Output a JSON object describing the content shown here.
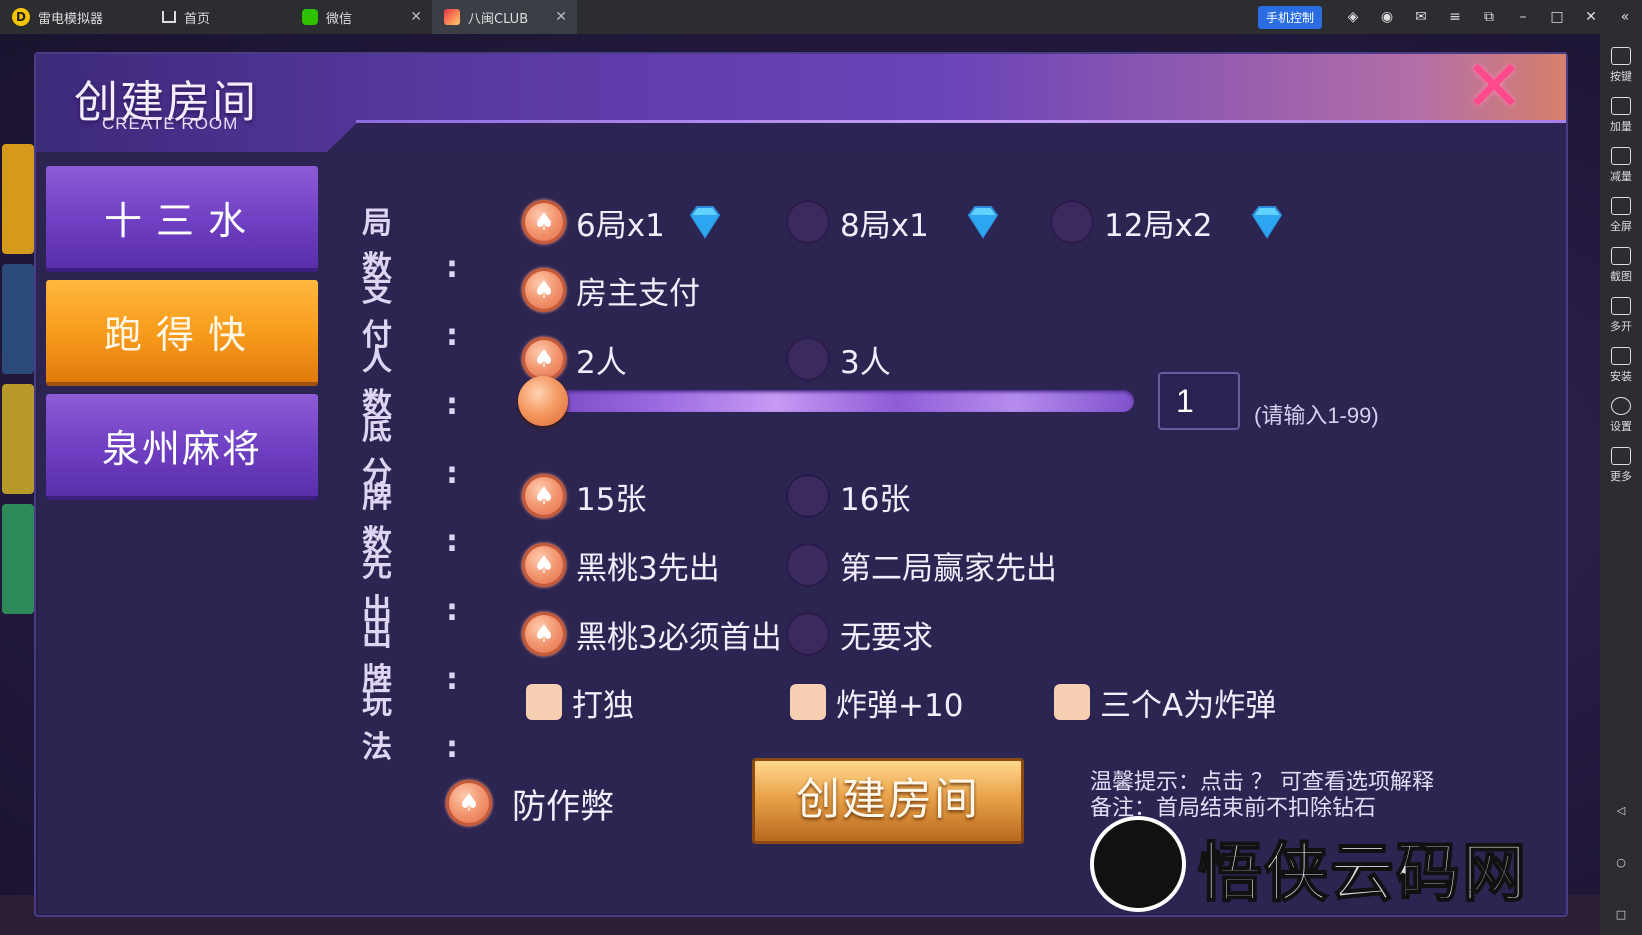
{
  "emulator": {
    "app_name": "雷电模拟器",
    "tabs": [
      {
        "label": "首页"
      },
      {
        "label": "微信"
      },
      {
        "label": "八闽CLUB"
      }
    ],
    "phone_control": "手机控制",
    "sidebar": [
      {
        "label": "按键",
        "icon": "keyboard-icon"
      },
      {
        "label": "加量",
        "icon": "volume-up-icon"
      },
      {
        "label": "减量",
        "icon": "volume-down-icon"
      },
      {
        "label": "全屏",
        "icon": "fullscreen-icon"
      },
      {
        "label": "截图",
        "icon": "scissors-icon"
      },
      {
        "label": "多开",
        "icon": "multi-instance-icon"
      },
      {
        "label": "安装",
        "icon": "apk-install-icon"
      },
      {
        "label": "设置",
        "icon": "gear-icon"
      },
      {
        "label": "更多",
        "icon": "more-icon"
      }
    ]
  },
  "dialog": {
    "title": "创建房间",
    "subtitle": "CREATE ROOM",
    "close": "✕",
    "game_tabs": [
      {
        "label": "十三水",
        "active": false
      },
      {
        "label": "跑得快",
        "active": true
      },
      {
        "label": "泉州麻将",
        "active": false
      }
    ],
    "rows": {
      "rounds": {
        "label": "局数:",
        "options": [
          "6局x1",
          "8局x1",
          "12局x2"
        ],
        "selected": 0
      },
      "payment": {
        "label": "支付:",
        "options": [
          "房主支付"
        ],
        "selected": 0
      },
      "players": {
        "label": "人数:",
        "options": [
          "2人",
          "3人"
        ],
        "selected": 0
      },
      "base_score": {
        "label": "底分:",
        "value": "1",
        "hint": "(请输入1-99)",
        "slider_fraction": 0.0
      },
      "cards": {
        "label": "牌数:",
        "options": [
          "15张",
          "16张"
        ],
        "selected": 0
      },
      "first": {
        "label": "先出:",
        "options": [
          "黑桃3先出",
          "第二局赢家先出"
        ],
        "selected": 0
      },
      "play": {
        "label": "出牌:",
        "options": [
          "黑桃3必须首出",
          "无要求"
        ],
        "selected": 0
      },
      "rules": {
        "label": "玩法:",
        "options": [
          "打独",
          "炸弹+10",
          "三个A为炸弹"
        ]
      }
    },
    "anticheat": "防作弊",
    "create_button": "创建房间",
    "tip_line1": "温馨提示：点击 ？ 可查看选项解释",
    "tip_line2": "备注：首局结束前不扣除钻石"
  },
  "watermark": "悟侠云码网",
  "colors": {
    "accent_orange": "#f79a1b",
    "accent_purple": "#6e3fc2",
    "close_pink": "#ff4b8d"
  }
}
